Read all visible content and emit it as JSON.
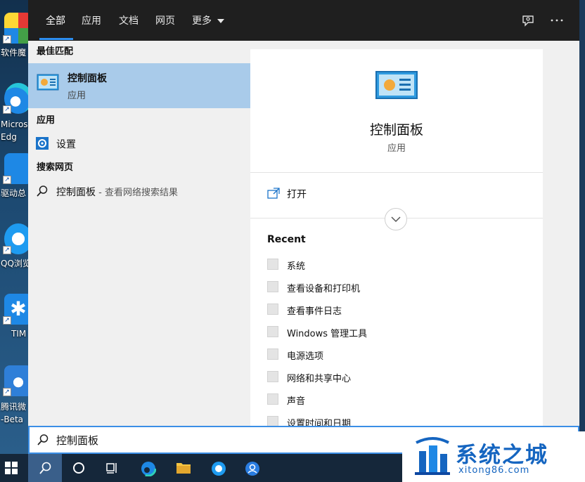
{
  "desktop": {
    "icons": [
      {
        "label": "软件魔",
        "icon": "software-icon"
      },
      {
        "label": "Micros\nEdg",
        "icon": "edge-icon"
      },
      {
        "label": "驱动总",
        "icon": "driver-icon"
      },
      {
        "label": "QQ浏览",
        "icon": "qq-browser-icon"
      },
      {
        "label": "TIM",
        "icon": "tim-icon"
      },
      {
        "label": "腾讯微\n-Beta",
        "icon": "tencent-weiyun-icon"
      }
    ]
  },
  "search": {
    "tabs": [
      {
        "label": "全部",
        "active": true
      },
      {
        "label": "应用"
      },
      {
        "label": "文档"
      },
      {
        "label": "网页"
      },
      {
        "label": "更多"
      }
    ],
    "query": "控制面板",
    "sections": {
      "best_match": "最佳匹配",
      "apps": "应用",
      "web": "搜索网页"
    },
    "best_match": {
      "name": "控制面板",
      "type": "应用"
    },
    "apps": [
      {
        "label": "设置"
      }
    ],
    "web": {
      "label": "控制面板",
      "sub": " - 查看网络搜索结果"
    },
    "preview": {
      "title": "控制面板",
      "subtitle": "应用",
      "open_label": "打开",
      "recent_title": "Recent",
      "recent": [
        "系统",
        "查看设备和打印机",
        "查看事件日志",
        "Windows 管理工具",
        "电源选项",
        "网络和共享中心",
        "声音",
        "设置时间和日期"
      ]
    }
  },
  "taskbar": {
    "items": [
      "start-icon",
      "search-icon",
      "cortana-icon",
      "task-view-icon",
      "edge-icon",
      "file-explorer-icon",
      "qq-browser-icon",
      "contact-icon"
    ]
  },
  "watermark": {
    "title": "系统之城",
    "url": "xitong86.com"
  },
  "colors": {
    "accent": "#2e8ff0",
    "selection": "#a9cbea",
    "topbar": "#1f1f1f",
    "taskbar": "#15273a"
  }
}
